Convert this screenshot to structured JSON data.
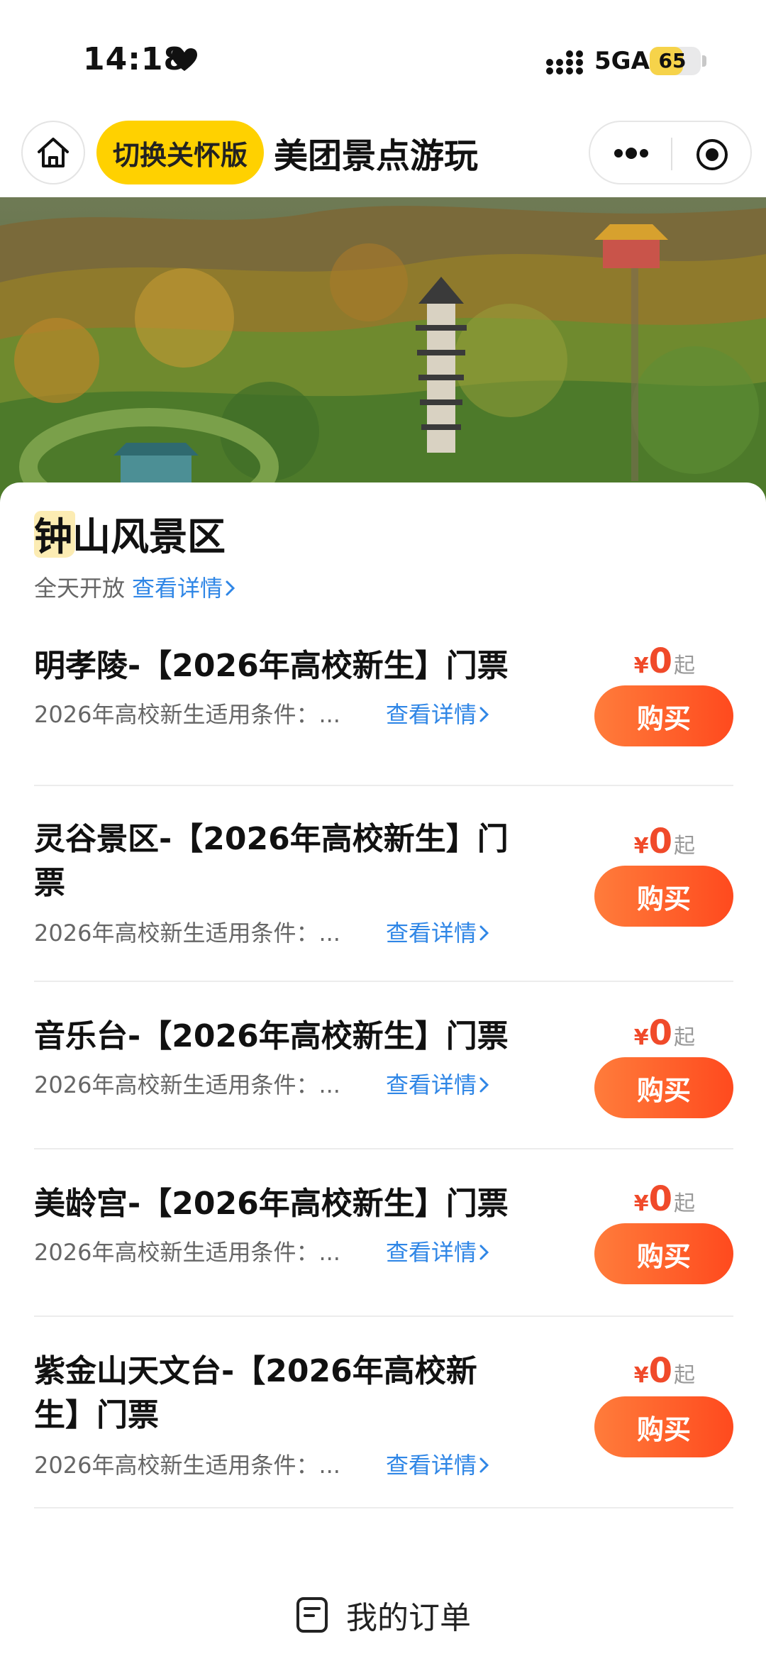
{
  "status_bar": {
    "time": "14:18",
    "network": "5GA",
    "battery": 65
  },
  "header": {
    "care_mode_label": "切换关怀版",
    "title": "美团景点游玩"
  },
  "scenic": {
    "name": "钟山风景区",
    "open_hours": "全天开放",
    "detail_link": "查看详情"
  },
  "tickets": [
    {
      "name": "明孝陵-【2026年高校新生】门票",
      "condition": "2026年高校新生适用条件：...",
      "detail_link": "查看详情",
      "price_symbol": "¥",
      "price": "0",
      "price_suffix": "起",
      "buy_label": "购买"
    },
    {
      "name": "灵谷景区-【2026年高校新生】门票",
      "condition": "2026年高校新生适用条件：...",
      "detail_link": "查看详情",
      "price_symbol": "¥",
      "price": "0",
      "price_suffix": "起",
      "buy_label": "购买"
    },
    {
      "name": "音乐台-【2026年高校新生】门票",
      "condition": "2026年高校新生适用条件：...",
      "detail_link": "查看详情",
      "price_symbol": "¥",
      "price": "0",
      "price_suffix": "起",
      "buy_label": "购买"
    },
    {
      "name": "美龄宫-【2026年高校新生】门票",
      "condition": "2026年高校新生适用条件：...",
      "detail_link": "查看详情",
      "price_symbol": "¥",
      "price": "0",
      "price_suffix": "起",
      "buy_label": "购买"
    },
    {
      "name": "紫金山天文台-【2026年高校新生】门票",
      "condition": "2026年高校新生适用条件：...",
      "detail_link": "查看详情",
      "price_symbol": "¥",
      "price": "0",
      "price_suffix": "起",
      "buy_label": "购买"
    }
  ],
  "footer": {
    "my_orders_label": "我的订单"
  },
  "colors": {
    "accent_yellow": "#ffd100",
    "link_blue": "#2f86e6",
    "price_red": "#f04a2a",
    "buy_gradient_start": "#ff7c3b",
    "buy_gradient_end": "#ff4a1e"
  },
  "icons": {
    "home": "home-icon",
    "more": "more-dots-icon",
    "close_target": "target-icon",
    "orders": "order-list-icon",
    "chevron": "chevron-right-icon"
  }
}
